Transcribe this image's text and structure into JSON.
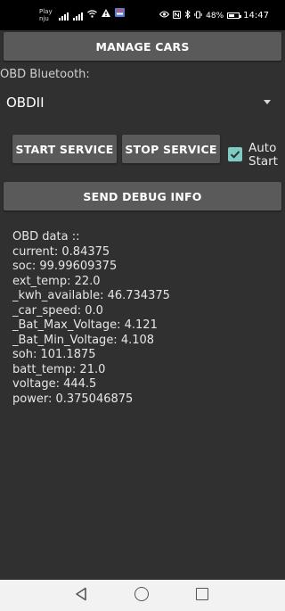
{
  "status_bar": {
    "carrier_line1": "Play",
    "carrier_line2": "nju",
    "battery_text": "48%",
    "time": "14:47",
    "icons": [
      "signal-icon",
      "signal-icon",
      "wifi-icon",
      "warning-icon",
      "app-notification-icon",
      "eye-icon",
      "nfc-icon",
      "bluetooth-icon",
      "vibrate-icon",
      "battery-icon"
    ]
  },
  "buttons": {
    "manage_cars": "MANAGE CARS",
    "start_service": "START SERVICE",
    "stop_service": "STOP SERVICE",
    "send_debug": "SEND DEBUG INFO"
  },
  "obd": {
    "label": "OBD Bluetooth:",
    "selected_device": "OBDII"
  },
  "auto_start": {
    "label": "Auto Start",
    "checked": true
  },
  "obd_data": {
    "header": "OBD data ::",
    "lines": [
      "current: 0.84375",
      "soc: 99.99609375",
      "ext_temp: 22.0",
      "_kwh_available: 46.734375",
      "_car_speed: 0.0",
      "_Bat_Max_Voltage: 4.121",
      "_Bat_Min_Voltage: 4.108",
      "soh: 101.1875",
      "batt_temp: 21.0",
      "voltage: 444.5",
      "power: 0.375046875"
    ]
  },
  "colors": {
    "background": "#303030",
    "button": "#5a5a5a",
    "checkbox_accent": "#80cbc4",
    "nav_bar": "#f2f2f2"
  }
}
